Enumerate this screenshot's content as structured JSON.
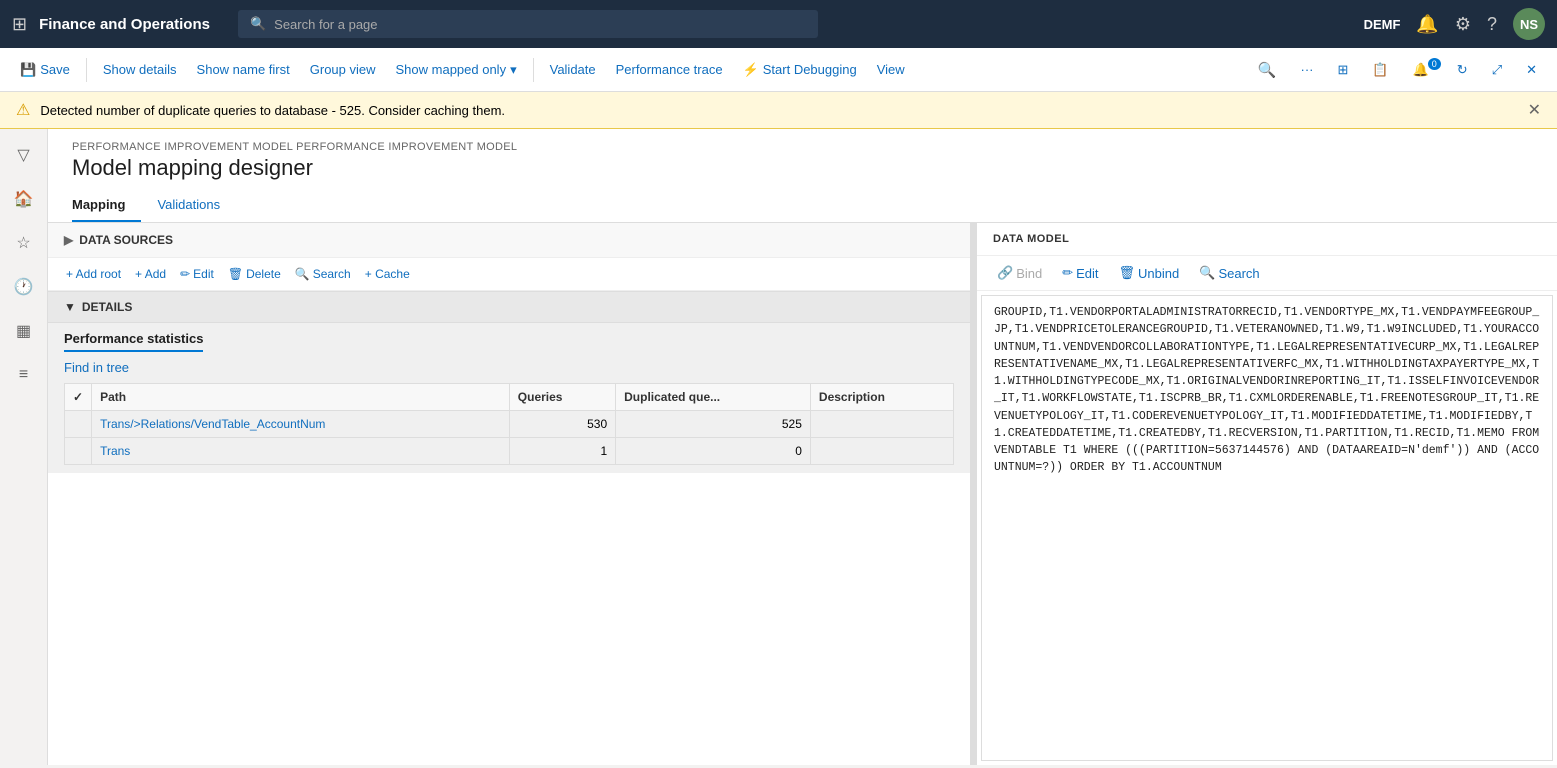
{
  "app": {
    "title": "Finance and Operations",
    "env": "DEMF",
    "search_placeholder": "Search for a page"
  },
  "toolbar": {
    "save": "Save",
    "show_details": "Show details",
    "show_name_first": "Show name first",
    "group_view": "Group view",
    "show_mapped_only": "Show mapped only",
    "validate": "Validate",
    "performance_trace": "Performance trace",
    "start_debugging": "Start Debugging",
    "view": "View"
  },
  "warning": {
    "message": "Detected number of duplicate queries to database - 525. Consider caching them."
  },
  "page": {
    "breadcrumb": "PERFORMANCE IMPROVEMENT MODEL PERFORMANCE IMPROVEMENT MODEL",
    "title": "Model mapping designer"
  },
  "tabs": [
    {
      "label": "Mapping",
      "active": true
    },
    {
      "label": "Validations",
      "active": false
    }
  ],
  "data_sources": {
    "label": "DATA SOURCES",
    "add_root": "+ Add root",
    "add": "+ Add",
    "edit": "Edit",
    "delete": "Delete",
    "search": "Search",
    "cache": "+ Cache"
  },
  "details": {
    "label": "DETAILS",
    "tab": "Performance statistics",
    "find_in_tree": "Find in tree",
    "table": {
      "headers": [
        "",
        "Path",
        "Queries",
        "Duplicated que...",
        "Description"
      ],
      "rows": [
        {
          "path": "Trans/>Relations/VendTable_AccountNum",
          "queries": "530",
          "duplicated": "525",
          "description": ""
        },
        {
          "path": "Trans",
          "queries": "1",
          "duplicated": "0",
          "description": ""
        }
      ]
    }
  },
  "data_model": {
    "label": "DATA MODEL",
    "bind": "Bind",
    "edit": "Edit",
    "unbind": "Unbind",
    "search": "Search"
  },
  "sql_content": "GROUPID,T1.VENDORPORTALADMINISTRATORRECID,T1.VENDORTYPE_MX,T1.VENDPAYMFEEGROUP_JP,T1.VENDPRICETOLERANCEGROUPID,T1.VETERANOWNED,T1.W9,T1.W9INCLUDED,T1.YOURACCOUNTNUM,T1.VENDVENDORCOLLABORATIONTYPE,T1.LEGALREPRESENTATIVECURP_MX,T1.LEGALREPRESENTATIVENAME_MX,T1.LEGALREPRESENTATIVERFC_MX,T1.WITHHOLDINGTAXPAYERTYPE_MX,T1.WITHHOLDINGTYPECODE_MX,T1.ORIGINALVENDORINREPORTING_IT,T1.ISSELFINVOICEVENDOR_IT,T1.WORKFLOWSTATE,T1.ISCPRB_BR,T1.CXMLORDERENABLE,T1.FREENOTESGROUP_IT,T1.REVENUETYPOLOGY_IT,T1.CODEREVENUETYPOLOGY_IT,T1.MODIFIEDDATETIME,T1.MODIFIEDBY,T1.CREATEDDATETIME,T1.CREATEDBY,T1.RECVERSION,T1.PARTITION,T1.RECID,T1.MEMO FROM VENDTABLE T1 WHERE (((PARTITION=5637144576) AND (DATAAREAID=N'demf')) AND (ACCOUNTNUM=?)) ORDER BY T1.ACCOUNTNUM"
}
